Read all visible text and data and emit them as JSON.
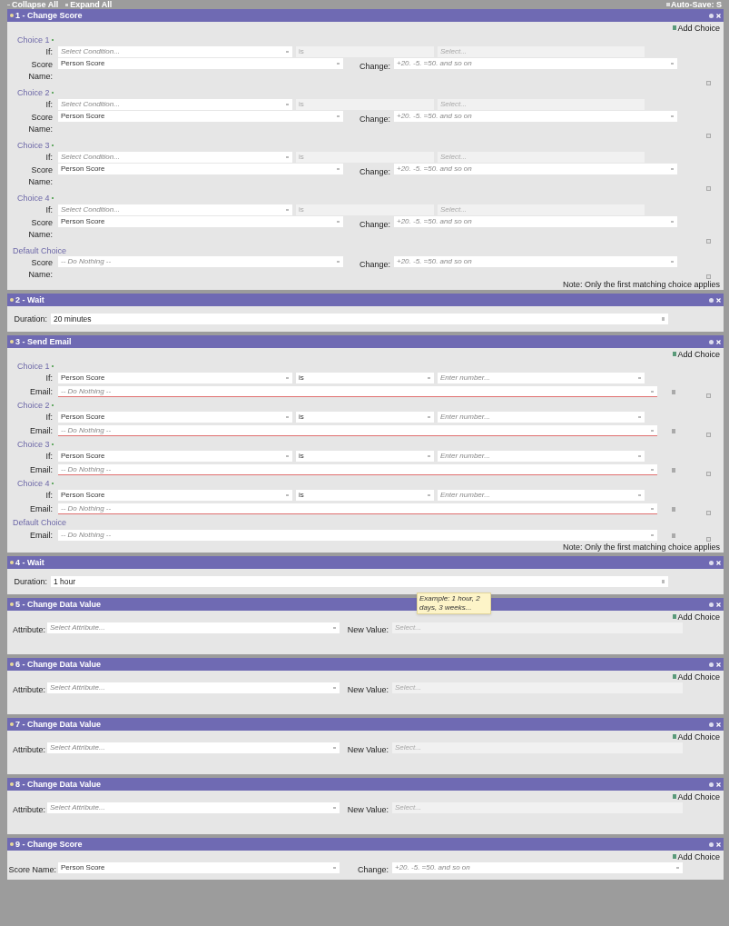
{
  "toolbar": {
    "collapse_all": "Collapse All",
    "expand_all": "Expand All",
    "auto_save": "Auto-Save: S"
  },
  "steps": [
    {
      "kind": "choices",
      "title": "1 - Change Score",
      "add_choice": "Add Choice",
      "choices": [
        {
          "label": "Choice 1",
          "if_label": "If:",
          "condition": {
            "placeholder": "Select Condition..."
          },
          "operator": {
            "value": "is",
            "disabled": true
          },
          "operand": {
            "placeholder": "Select...",
            "disabled": true
          },
          "action_label": "Score Name:",
          "action": {
            "value": "Person Score"
          },
          "change_label": "Change:",
          "change": {
            "placeholder": "+20. -5. =50. and so on"
          }
        },
        {
          "label": "Choice 2",
          "if_label": "If:",
          "condition": {
            "placeholder": "Select Condition..."
          },
          "operator": {
            "value": "is",
            "disabled": true
          },
          "operand": {
            "placeholder": "Select...",
            "disabled": true
          },
          "action_label": "Score Name:",
          "action": {
            "value": "Person Score"
          },
          "change_label": "Change:",
          "change": {
            "placeholder": "+20. -5. =50. and so on"
          }
        },
        {
          "label": "Choice 3",
          "if_label": "If:",
          "condition": {
            "placeholder": "Select Condition..."
          },
          "operator": {
            "value": "is",
            "disabled": true
          },
          "operand": {
            "placeholder": "Select...",
            "disabled": true
          },
          "action_label": "Score Name:",
          "action": {
            "value": "Person Score"
          },
          "change_label": "Change:",
          "change": {
            "placeholder": "+20. -5. =50. and so on"
          }
        },
        {
          "label": "Choice 4",
          "if_label": "If:",
          "condition": {
            "placeholder": "Select Condition..."
          },
          "operator": {
            "value": "is",
            "disabled": true
          },
          "operand": {
            "placeholder": "Select...",
            "disabled": true
          },
          "action_label": "Score Name:",
          "action": {
            "value": "Person Score"
          },
          "change_label": "Change:",
          "change": {
            "placeholder": "+20. -5. =50. and so on"
          }
        },
        {
          "label": "Default Choice",
          "action_label": "Score Name:",
          "action": {
            "placeholder": "-- Do Nothing --"
          },
          "change_label": "Change:",
          "change": {
            "placeholder": "+20. -5. =50. and so on"
          }
        }
      ],
      "note": "Note: Only the first matching choice applies"
    },
    {
      "kind": "wait",
      "title": "2 - Wait",
      "label": "Duration:",
      "field": {
        "value": "20 minutes"
      }
    },
    {
      "kind": "choices",
      "title": "3 - Send Email",
      "add_choice": "Add Choice",
      "choices": [
        {
          "label": "Choice 1",
          "if_label": "If:",
          "condition": {
            "value": "Person Score"
          },
          "operator": {
            "value": "is",
            "disabled": false
          },
          "operand": {
            "placeholder": "Enter number...",
            "disabled": false
          },
          "action_label": "Email:",
          "action": {
            "placeholder": "-- Do Nothing --",
            "invalid": true
          }
        },
        {
          "label": "Choice 2",
          "if_label": "If:",
          "condition": {
            "value": "Person Score"
          },
          "operator": {
            "value": "is",
            "disabled": false
          },
          "operand": {
            "placeholder": "Enter number...",
            "disabled": false
          },
          "action_label": "Email:",
          "action": {
            "placeholder": "-- Do Nothing --",
            "invalid": true
          }
        },
        {
          "label": "Choice 3",
          "if_label": "If:",
          "condition": {
            "value": "Person Score"
          },
          "operator": {
            "value": "is",
            "disabled": false
          },
          "operand": {
            "placeholder": "Enter number...",
            "disabled": false
          },
          "action_label": "Email:",
          "action": {
            "placeholder": "-- Do Nothing --",
            "invalid": true
          }
        },
        {
          "label": "Choice 4",
          "if_label": "If:",
          "condition": {
            "value": "Person Score"
          },
          "operator": {
            "value": "is",
            "disabled": false
          },
          "operand": {
            "placeholder": "Enter number...",
            "disabled": false
          },
          "action_label": "Email:",
          "action": {
            "placeholder": "-- Do Nothing --",
            "invalid": true
          }
        },
        {
          "label": "Default Choice",
          "action_label": "Email:",
          "action": {
            "placeholder": "-- Do Nothing --",
            "invalid": false
          }
        }
      ],
      "note": "Note: Only the first matching choice applies"
    },
    {
      "kind": "wait",
      "title": "4 - Wait",
      "label": "Duration:",
      "field": {
        "value": "1 hour"
      },
      "tooltip": "Example: 1 hour, 2 days, 3 weeks..."
    },
    {
      "kind": "data_value",
      "title": "5 - Change Data Value",
      "add_choice": "Add Choice",
      "label": "Attribute:",
      "field": {
        "placeholder": "Select Attribute..."
      },
      "label2": "New Value:",
      "field2": {
        "placeholder": "Select...",
        "disabled": true
      }
    },
    {
      "kind": "data_value",
      "title": "6 - Change Data Value",
      "add_choice": "Add Choice",
      "label": "Attribute:",
      "field": {
        "placeholder": "Select Attribute..."
      },
      "label2": "New Value:",
      "field2": {
        "placeholder": "Select...",
        "disabled": true
      }
    },
    {
      "kind": "data_value",
      "title": "7 - Change Data Value",
      "add_choice": "Add Choice",
      "label": "Attribute:",
      "field": {
        "placeholder": "Select Attribute..."
      },
      "label2": "New Value:",
      "field2": {
        "placeholder": "Select...",
        "disabled": true
      }
    },
    {
      "kind": "data_value",
      "title": "8 - Change Data Value",
      "add_choice": "Add Choice",
      "label": "Attribute:",
      "field": {
        "placeholder": "Select Attribute..."
      },
      "label2": "New Value:",
      "field2": {
        "placeholder": "Select...",
        "disabled": true
      }
    },
    {
      "kind": "score",
      "title": "9 - Change Score",
      "add_choice": "Add Choice",
      "label": "Score Name:",
      "field": {
        "value": "Person Score"
      },
      "label2": "Change:",
      "field2": {
        "placeholder": "+20. -5. =50. and so on"
      }
    }
  ]
}
